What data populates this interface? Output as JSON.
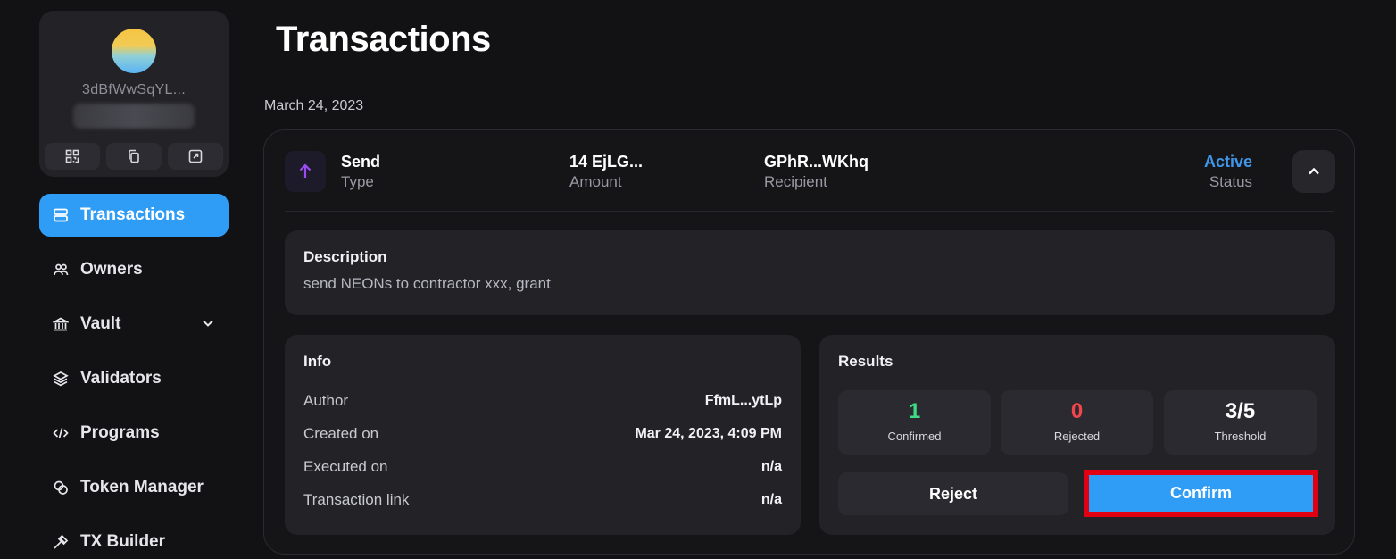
{
  "sidebar": {
    "wallet": {
      "address": "3dBfWwSqYL...",
      "actions": [
        {
          "icon": "qr-code-icon"
        },
        {
          "icon": "copy-icon"
        },
        {
          "icon": "external-link-icon"
        }
      ]
    },
    "nav": [
      {
        "label": "Transactions",
        "icon": "list-icon",
        "active": true
      },
      {
        "label": "Owners",
        "icon": "users-icon"
      },
      {
        "label": "Vault",
        "icon": "bank-icon",
        "has_dropdown": true
      },
      {
        "label": "Validators",
        "icon": "layers-icon"
      },
      {
        "label": "Programs",
        "icon": "code-icon"
      },
      {
        "label": "Token Manager",
        "icon": "coins-icon"
      },
      {
        "label": "TX Builder",
        "icon": "hammer-icon"
      }
    ]
  },
  "main": {
    "title": "Transactions",
    "date": "March 24, 2023",
    "transaction": {
      "type_value": "Send",
      "type_label": "Type",
      "amount_value": "14 EjLG...",
      "amount_label": "Amount",
      "recipient_value": "GPhR...WKhq",
      "recipient_label": "Recipient",
      "status_value": "Active",
      "status_label": "Status",
      "status_color": "#3f97ea",
      "description": {
        "title": "Description",
        "text": "send NEONs to contractor xxx, grant"
      },
      "info": {
        "title": "Info",
        "rows": [
          {
            "key": "Author",
            "value": "FfmL...ytLp"
          },
          {
            "key": "Created on",
            "value": "Mar 24, 2023, 4:09 PM"
          },
          {
            "key": "Executed on",
            "value": "n/a"
          },
          {
            "key": "Transaction link",
            "value": "n/a"
          }
        ]
      },
      "results": {
        "title": "Results",
        "confirmed": {
          "value": "1",
          "label": "Confirmed",
          "color": "#3ddc84"
        },
        "rejected": {
          "value": "0",
          "label": "Rejected",
          "color": "#f0464c"
        },
        "threshold": {
          "value": "3/5",
          "label": "Threshold"
        },
        "reject_label": "Reject",
        "confirm_label": "Confirm"
      }
    }
  },
  "colors": {
    "accent": "#2f9cf5",
    "highlight": "#e00012",
    "background": "#121214",
    "panel": "#222227"
  }
}
